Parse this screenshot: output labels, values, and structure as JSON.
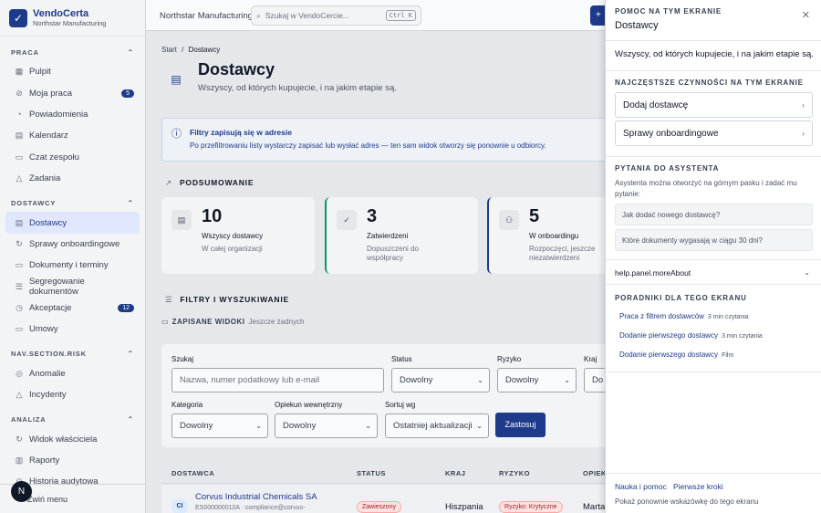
{
  "brand": {
    "logo_glyph": "✓",
    "name": "VendoCerta",
    "org": "Northstar Manufacturing"
  },
  "sidebar": {
    "sections": [
      {
        "title": "PRACA",
        "items": [
          {
            "label": "Pulpit",
            "icon": "▦"
          },
          {
            "label": "Moja praca",
            "icon": "⊘",
            "badge": "5"
          },
          {
            "label": "Powiadomienia",
            "icon": "◔"
          },
          {
            "label": "Kalendarz",
            "icon": "▤"
          },
          {
            "label": "Czat zespołu",
            "icon": "▭"
          },
          {
            "label": "Zadania",
            "icon": "△"
          }
        ]
      },
      {
        "title": "DOSTAWCY",
        "items": [
          {
            "label": "Dostawcy",
            "icon": "▤",
            "active": true
          },
          {
            "label": "Sprawy onboardingowe",
            "icon": "↻"
          },
          {
            "label": "Dokumenty i terminy",
            "icon": "▭"
          },
          {
            "label": "Segregowanie dokumentów",
            "icon": "☰"
          },
          {
            "label": "Akceptacje",
            "icon": "◷",
            "badge": "12"
          },
          {
            "label": "Umowy",
            "icon": "▭"
          }
        ]
      },
      {
        "title": "NAV.SECTION.RISK",
        "items": [
          {
            "label": "Anomalie",
            "icon": "◎"
          },
          {
            "label": "Incydenty",
            "icon": "△"
          }
        ]
      },
      {
        "title": "ANALIZA",
        "items": [
          {
            "label": "Widok właściciela",
            "icon": "↻"
          },
          {
            "label": "Raporty",
            "icon": "▥"
          },
          {
            "label": "Historia audytowa",
            "icon": "⊙"
          }
        ]
      }
    ],
    "collapse_label": "Zwiń menu",
    "fab_glyph": "N"
  },
  "topbar": {
    "org_name": "Northstar Manufacturing",
    "search_placeholder": "Szukaj w VendoCercie...",
    "search_shortcut": "Ctrl K",
    "new_button": "+"
  },
  "main": {
    "breadcrumb": {
      "home": "Start",
      "sep": "/",
      "current": "Dostawcy"
    },
    "title": "Dostawcy",
    "subtitle": "Wszyscy, od których kupujecie, i na jakim etapie są.",
    "info_title": "Filtry zapisują się w adresie",
    "info_desc": "Po przefiltrowaniu listy wystarczy zapisać lub wysłać adres — ten sam widok otworzy się ponownie u odbiorcy.",
    "summary_title": "PODSUMOWANIE",
    "cards": [
      {
        "num": "10",
        "label": "Wszyscy dostawcy",
        "sub": "W całej organizacji",
        "icon": "▤"
      },
      {
        "num": "3",
        "label": "Zatwierdzeni",
        "sub": "Dopuszczeni do współpracy",
        "icon": "✓"
      },
      {
        "num": "5",
        "label": "W onboardingu",
        "sub": "Rozpoczęci, jeszcze niezatwierdzeni",
        "icon": "⚇"
      }
    ],
    "filters_title": "FILTRY I WYSZUKIWANIE",
    "saved_label": "ZAPISANE WIDOKI",
    "saved_empty": "Jeszcze żadnych",
    "filters": {
      "search_label": "Szukaj",
      "search_placeholder": "Nazwa, numer podatkowy lub e-mail",
      "status_label": "Status",
      "status_value": "Dowolny",
      "risk_label": "Ryzyko",
      "risk_value": "Dowolny",
      "country_label": "Kraj",
      "country_value": "Do",
      "category_label": "Kategoria",
      "category_value": "Dowolny",
      "owner_label": "Opiekun wewnętrzny",
      "owner_value": "Dowolny",
      "sort_label": "Sortuj wg",
      "sort_value": "Ostatniej aktualizacji",
      "apply": "Zastosuj"
    },
    "table": {
      "headers": [
        "DOSTAWCA",
        "STATUS",
        "KRAJ",
        "RYZYKO",
        "OPIEK"
      ],
      "rows": [
        {
          "initials": "CI",
          "name": "Corvus Industrial Chemicals SA",
          "sub": "ES000000010A · compliance@corvus-",
          "status": "Zawieszony",
          "country": "Hiszpania",
          "risk": "Ryzyko: Krytyczne",
          "owner": "Marta"
        }
      ]
    }
  },
  "help": {
    "kicker": "POMOC NA TYM EKRANIE",
    "title": "Dostawcy",
    "desc": "Wszyscy, od których kupujecie, i na jakim etapie są.",
    "actions_title": "NAJCZĘSTSZE CZYNNOŚCI NA TYM EKRANIE",
    "actions": [
      "Dodaj dostawcę",
      "Sprawy onboardingowe"
    ],
    "assistant_title": "PYTANIA DO ASYSTENTA",
    "assistant_note": "Asystenta można otworzyć na górnym pasku i zadać mu pytanie:",
    "questions": [
      "Jak dodać nowego dostawcę?",
      "Które dokumenty wygasają w ciągu 30 dni?"
    ],
    "more_about": "help.panel.moreAbout",
    "guides_title": "PORADNIKI DLA TEGO EKRANU",
    "guides": [
      {
        "title": "Praca z filtrem dostawców",
        "meta": "3 min czytania"
      },
      {
        "title": "Dodanie pierwszego dostawcy",
        "meta": "3 min czytania"
      },
      {
        "title": "Dodanie pierwszego dostawcy",
        "meta": "Film"
      }
    ],
    "footer_links": [
      "Nauka i pomoc",
      "Pierwsze kroki"
    ],
    "footer_note": "Pokaż ponownie wskazówkę do tego ekranu"
  }
}
